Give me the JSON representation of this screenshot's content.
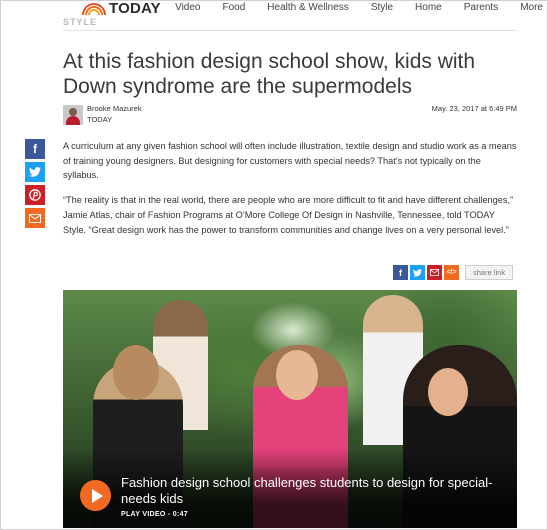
{
  "nav": {
    "logo": "TODAY",
    "links": [
      "Video",
      "Food",
      "Health & Wellness",
      "Style",
      "Home",
      "Parents",
      "More"
    ]
  },
  "section": "STYLE",
  "article": {
    "headline": "At this fashion design school show, kids with Down syndrome are the supermodels",
    "author": "Brooke Mazurek",
    "outlet": "TODAY",
    "date": "May. 23, 2017 at 6:49 PM",
    "paragraphs": [
      "A curriculum at any given fashion school will often include illustration, textile design and studio work as a means of training young designers. But designing for customers with special needs? That's not typically on the syllabus.",
      "“The reality is that in the real world, there are people who are more difficult to fit and have different challenges,” Jamie Atlas, chair of Fashion Programs at O’More College Of Design in Nashville, Tennessee, told TODAY Style. “Great design work has the power to transform communities and change lives on a very personal level.”"
    ]
  },
  "share": {
    "rail_icons": [
      "facebook-icon",
      "twitter-icon",
      "pinterest-icon",
      "email-icon"
    ],
    "row_icons": [
      "facebook-icon",
      "twitter-icon",
      "email-icon",
      "embed-icon"
    ],
    "link_label": "share link"
  },
  "video": {
    "title": "Fashion design school challenges students to design for special-needs kids",
    "meta": "PLAY VIDEO - 0:47"
  },
  "colors": {
    "facebook": "#3b5998",
    "twitter": "#1da1f2",
    "pinterest": "#cb2027",
    "email": "#f26a21",
    "play": "#f26a21"
  }
}
